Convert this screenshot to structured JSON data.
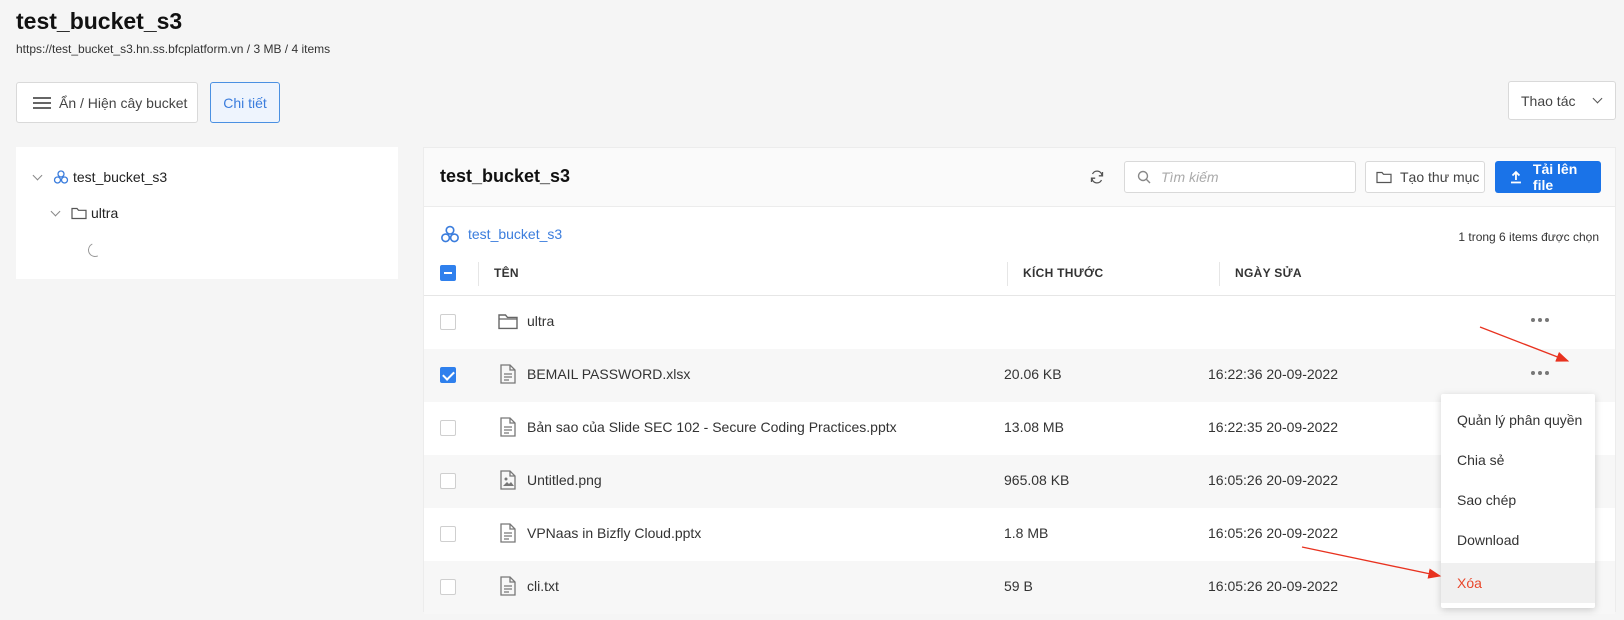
{
  "page": {
    "title": "test_bucket_s3",
    "subtitle": "https://test_bucket_s3.hn.ss.bfcplatform.vn / 3 MB / 4 items"
  },
  "toolbar": {
    "toggle_tree_label": "Ẩn / Hiện cây bucket",
    "detail_label": "Chi tiết",
    "actions_label": "Thao tác"
  },
  "tree": {
    "root": "test_bucket_s3",
    "child": "ultra"
  },
  "main": {
    "title": "test_bucket_s3",
    "search_placeholder": "Tìm kiếm",
    "mkdir_label": "Tạo thư mục",
    "upload_label": "Tải lên file",
    "breadcrumb": "test_bucket_s3",
    "selection_count": "1 trong 6 items được chọn",
    "columns": {
      "name": "TÊN",
      "size": "KÍCH THƯỚC",
      "date": "NGÀY SỬA"
    },
    "rows": [
      {
        "name": "ultra",
        "size": "",
        "date": "",
        "type": "folder",
        "checked": false
      },
      {
        "name": "BEMAIL PASSWORD.xlsx",
        "size": "20.06 KB",
        "date": "16:22:36 20-09-2022",
        "type": "file",
        "checked": true
      },
      {
        "name": "Bản sao của Slide SEC 102 - Secure Coding Practices.pptx",
        "size": "13.08 MB",
        "date": "16:22:35 20-09-2022",
        "type": "file",
        "checked": false
      },
      {
        "name": "Untitled.png",
        "size": "965.08 KB",
        "date": "16:05:26 20-09-2022",
        "type": "image",
        "checked": false
      },
      {
        "name": "VPNaas in Bizfly Cloud.pptx",
        "size": "1.8 MB",
        "date": "16:05:26 20-09-2022",
        "type": "file",
        "checked": false
      },
      {
        "name": "cli.txt",
        "size": "59 B",
        "date": "16:05:26 20-09-2022",
        "type": "file",
        "checked": false
      }
    ]
  },
  "context_menu": {
    "items": [
      "Quản lý phân quyền",
      "Chia sẻ",
      "Sao chép",
      "Download",
      "Xóa"
    ]
  },
  "colors": {
    "primary": "#1a73e8",
    "danger": "#e8472b",
    "annotation_arrow": "#e8321f"
  }
}
